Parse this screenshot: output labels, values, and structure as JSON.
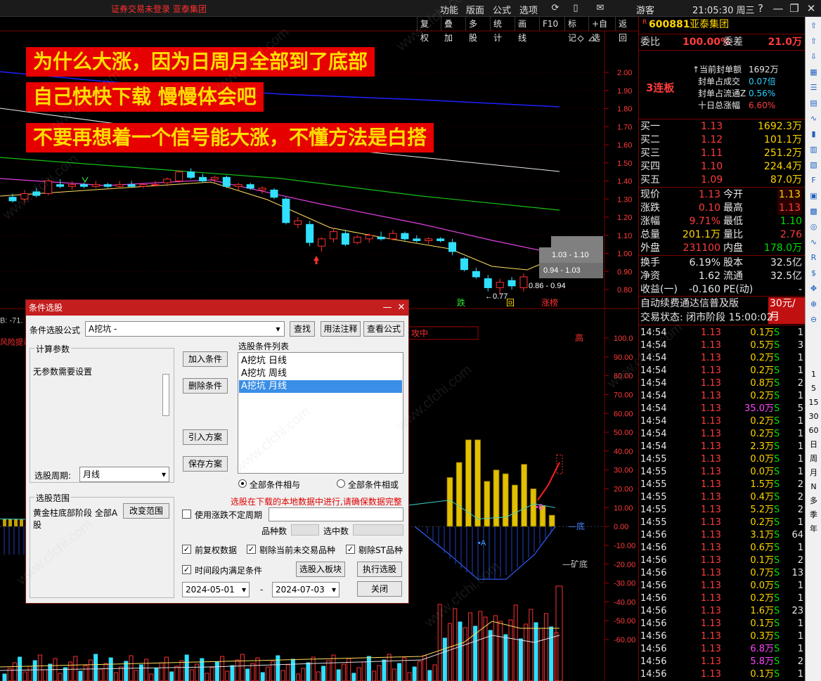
{
  "titlebar": {
    "notice": "证券交易未登录  亚泰集团",
    "menu": [
      "功能",
      "版面",
      "公式",
      "选项"
    ],
    "user": "游客",
    "time": "21:05:30 周三",
    "icons": [
      "refresh-icon",
      "phone-icon",
      "mail-icon"
    ]
  },
  "chart_toolbar": [
    "复权",
    "叠加",
    "多股",
    "统计",
    "画线",
    "F10",
    "标记",
    "+自选",
    "返回"
  ],
  "banners": [
    "为什么大涨，因为日周月全部到了底部",
    "自己快快下载     慢慢体会吧",
    "不要再想着一个信号能大涨，不懂方法是白搭"
  ],
  "watermark": "www.cfchi.com",
  "chart_data": {
    "type": "candlestick",
    "price_axis": [
      "2.00",
      "1.90",
      "1.80",
      "1.70",
      "1.60",
      "1.50",
      "1.40",
      "1.30",
      "1.20",
      "1.10",
      "1.00",
      "0.90",
      "0.80"
    ],
    "price_range": [
      0.75,
      2.05
    ],
    "annotations": {
      "range_label_1": "1.03 - 1.10",
      "range_label_2": "0.94 - 1.03",
      "range_label_3": "0.86 - 0.94",
      "low_label": "←0.77",
      "tag_die": "跌",
      "tag_hui": "回",
      "tag_zhangbang": "涨榜"
    },
    "indicator_axis": [
      "100.0",
      "90.00",
      "80.00",
      "70.00",
      "60.00",
      "50.00",
      "40.00",
      "30.00",
      "20.00",
      "10.00",
      "0.00",
      "-10.00",
      "-20.00",
      "-30.00",
      "-40.00",
      "-50.00",
      "-60.00"
    ],
    "indicator_labels": {
      "high": "高",
      "bottom": "底",
      "mine_bottom": "矿底",
      "marker_a": "A",
      "marker_b": "B",
      "left_cut": "B: -71.",
      "risk": "风险提示"
    },
    "bars": [
      26,
      34,
      46,
      46,
      24,
      30,
      28,
      22,
      33,
      20,
      11,
      6
    ],
    "candles": [
      {
        "o": 1.31,
        "h": 1.33,
        "l": 1.28,
        "c": 1.29
      },
      {
        "o": 1.3,
        "h": 1.35,
        "l": 1.28,
        "c": 1.33
      },
      {
        "o": 1.34,
        "h": 1.36,
        "l": 1.31,
        "c": 1.32
      },
      {
        "o": 1.33,
        "h": 1.41,
        "l": 1.32,
        "c": 1.4
      },
      {
        "o": 1.38,
        "h": 1.41,
        "l": 1.36,
        "c": 1.37
      },
      {
        "o": 1.37,
        "h": 1.4,
        "l": 1.35,
        "c": 1.38
      },
      {
        "o": 1.38,
        "h": 1.39,
        "l": 1.36,
        "c": 1.37
      },
      {
        "o": 1.37,
        "h": 1.4,
        "l": 1.36,
        "c": 1.38
      },
      {
        "o": 1.38,
        "h": 1.39,
        "l": 1.36,
        "c": 1.37
      },
      {
        "o": 1.37,
        "h": 1.4,
        "l": 1.36,
        "c": 1.38
      },
      {
        "o": 1.38,
        "h": 1.4,
        "l": 1.37,
        "c": 1.37
      },
      {
        "o": 1.37,
        "h": 1.39,
        "l": 1.36,
        "c": 1.38
      },
      {
        "o": 1.38,
        "h": 1.4,
        "l": 1.37,
        "c": 1.38
      },
      {
        "o": 1.39,
        "h": 1.42,
        "l": 1.37,
        "c": 1.41
      },
      {
        "o": 1.4,
        "h": 1.46,
        "l": 1.39,
        "c": 1.45
      },
      {
        "o": 1.45,
        "h": 1.47,
        "l": 1.41,
        "c": 1.42
      },
      {
        "o": 1.42,
        "h": 1.44,
        "l": 1.39,
        "c": 1.4
      },
      {
        "o": 1.41,
        "h": 1.43,
        "l": 1.39,
        "c": 1.42
      },
      {
        "o": 1.42,
        "h": 1.43,
        "l": 1.36,
        "c": 1.37
      },
      {
        "o": 1.37,
        "h": 1.39,
        "l": 1.35,
        "c": 1.38
      },
      {
        "o": 1.38,
        "h": 1.39,
        "l": 1.35,
        "c": 1.36
      },
      {
        "o": 1.35,
        "h": 1.37,
        "l": 1.33,
        "c": 1.36
      },
      {
        "o": 1.35,
        "h": 1.36,
        "l": 1.3,
        "c": 1.31
      },
      {
        "o": 1.3,
        "h": 1.31,
        "l": 1.16,
        "c": 1.17
      },
      {
        "o": 1.16,
        "h": 1.2,
        "l": 1.14,
        "c": 1.18
      },
      {
        "o": 1.16,
        "h": 1.18,
        "l": 1.04,
        "c": 1.06
      },
      {
        "o": 1.04,
        "h": 1.09,
        "l": 1.01,
        "c": 1.08
      },
      {
        "o": 1.08,
        "h": 1.14,
        "l": 1.06,
        "c": 1.12
      },
      {
        "o": 1.11,
        "h": 1.13,
        "l": 1.04,
        "c": 1.05
      },
      {
        "o": 1.06,
        "h": 1.1,
        "l": 1.05,
        "c": 1.09
      },
      {
        "o": 1.08,
        "h": 1.11,
        "l": 1.06,
        "c": 1.1
      },
      {
        "o": 1.09,
        "h": 1.12,
        "l": 1.07,
        "c": 1.08
      },
      {
        "o": 1.08,
        "h": 1.13,
        "l": 1.07,
        "c": 1.11
      },
      {
        "o": 1.11,
        "h": 1.12,
        "l": 1.07,
        "c": 1.08
      },
      {
        "o": 1.08,
        "h": 1.1,
        "l": 1.06,
        "c": 1.07
      },
      {
        "o": 1.07,
        "h": 1.09,
        "l": 1.05,
        "c": 1.08
      },
      {
        "o": 1.08,
        "h": 1.09,
        "l": 1.06,
        "c": 1.07
      },
      {
        "o": 1.06,
        "h": 1.08,
        "l": 0.99,
        "c": 1.01
      },
      {
        "o": 0.97,
        "h": 0.98,
        "l": 0.9,
        "c": 0.91
      },
      {
        "o": 0.9,
        "h": 0.92,
        "l": 0.86,
        "c": 0.87
      },
      {
        "o": 0.86,
        "h": 0.88,
        "l": 0.79,
        "c": 0.81
      },
      {
        "o": 0.81,
        "h": 0.86,
        "l": 0.77,
        "c": 0.84
      },
      {
        "o": 0.85,
        "h": 0.87,
        "l": 0.8,
        "c": 0.82
      },
      {
        "o": 0.81,
        "h": 0.89,
        "l": 0.79,
        "c": 0.87
      }
    ]
  },
  "stock": {
    "code": "600881",
    "name": "亚泰集团",
    "weibi_label": "委比",
    "weibi": "100.00%",
    "weicha_label": "委差",
    "weicha": "21.0万",
    "lianban": "3连板",
    "seal": [
      {
        "label": "当前封单额",
        "value": "1692万"
      },
      {
        "label": "封单占成交",
        "value": "0.07倍"
      },
      {
        "label": "封单占流通Z",
        "value": "0.56%"
      },
      {
        "label": "十日总涨幅",
        "value": "6.60%"
      }
    ],
    "bids": [
      {
        "label": "买一",
        "price": "1.13",
        "vol": "1692.3万"
      },
      {
        "label": "买二",
        "price": "1.12",
        "vol": "101.1万"
      },
      {
        "label": "买三",
        "price": "1.11",
        "vol": "251.2万"
      },
      {
        "label": "买四",
        "price": "1.10",
        "vol": "224.4万"
      },
      {
        "label": "买五",
        "price": "1.09",
        "vol": "87.0万"
      }
    ],
    "quote": [
      {
        "l1": "现价",
        "v1": "1.13",
        "l2": "今开",
        "v2": "1.13"
      },
      {
        "l1": "涨跌",
        "v1": "0.10",
        "l2": "最高",
        "v2": "1.13"
      },
      {
        "l1": "涨幅",
        "v1": "9.71%",
        "l2": "最低",
        "v2": "1.10"
      },
      {
        "l1": "总量",
        "v1": "201.1万",
        "l2": "量比",
        "v2": "2.76"
      },
      {
        "l1": "外盘",
        "v1": "231100",
        "l2": "内盘",
        "v2": "178.0万"
      }
    ],
    "fin": [
      {
        "l1": "换手",
        "v1": "6.19%",
        "l2": "股本",
        "v2": "32.5亿"
      },
      {
        "l1": "净资",
        "v1": "1.62",
        "l2": "流通",
        "v2": "32.5亿"
      },
      {
        "l1": "收益(一)",
        "v1": "-0.160",
        "l2": "PE(动)",
        "v2": "-"
      }
    ],
    "promo": "自动续费通达信普及版",
    "promo_price": "30元/月",
    "status": "交易状态: 闭市阶段 15:00:02",
    "ticks": [
      [
        "14:54",
        "1.13",
        "0.1万",
        "S",
        "1"
      ],
      [
        "14:54",
        "1.13",
        "0.5万",
        "S",
        "3"
      ],
      [
        "14:54",
        "1.13",
        "0.2万",
        "S",
        "1"
      ],
      [
        "14:54",
        "1.13",
        "0.2万",
        "S",
        "1"
      ],
      [
        "14:54",
        "1.13",
        "0.8万",
        "S",
        "2"
      ],
      [
        "14:54",
        "1.13",
        "0.2万",
        "S",
        "1"
      ],
      [
        "14:54",
        "1.13",
        "35.0万",
        "S",
        "5"
      ],
      [
        "14:54",
        "1.13",
        "0.2万",
        "S",
        "1"
      ],
      [
        "14:54",
        "1.13",
        "0.2万",
        "S",
        "1"
      ],
      [
        "14:54",
        "1.13",
        "2.3万",
        "S",
        "1"
      ],
      [
        "14:55",
        "1.13",
        "0.0万",
        "S",
        "1"
      ],
      [
        "14:55",
        "1.13",
        "0.0万",
        "S",
        "1"
      ],
      [
        "14:55",
        "1.13",
        "1.5万",
        "S",
        "2"
      ],
      [
        "14:55",
        "1.13",
        "0.4万",
        "S",
        "2"
      ],
      [
        "14:55",
        "1.13",
        "5.2万",
        "S",
        "2"
      ],
      [
        "14:55",
        "1.13",
        "0.2万",
        "S",
        "1"
      ],
      [
        "14:56",
        "1.13",
        "3.1万",
        "S",
        "64"
      ],
      [
        "14:56",
        "1.13",
        "0.6万",
        "S",
        "1"
      ],
      [
        "14:56",
        "1.13",
        "0.1万",
        "S",
        "2"
      ],
      [
        "14:56",
        "1.13",
        "0.7万",
        "S",
        "13"
      ],
      [
        "14:56",
        "1.13",
        "0.0万",
        "S",
        "1"
      ],
      [
        "14:56",
        "1.13",
        "0.2万",
        "S",
        "1"
      ],
      [
        "14:56",
        "1.13",
        "1.6万",
        "S",
        "23"
      ],
      [
        "14:56",
        "1.13",
        "0.1万",
        "S",
        "1"
      ],
      [
        "14:56",
        "1.13",
        "0.3万",
        "S",
        "1"
      ],
      [
        "14:56",
        "1.13",
        "6.8万",
        "S",
        "1"
      ],
      [
        "14:56",
        "1.13",
        "5.8万",
        "S",
        "2"
      ],
      [
        "14:56",
        "1.13",
        "0.1万",
        "S",
        "1"
      ]
    ]
  },
  "sidebar": [
    "1",
    "5",
    "15",
    "30",
    "60",
    "日",
    "周",
    "月",
    "N",
    "多",
    "季",
    "年"
  ],
  "sidebar_icons": [
    "arrow-up-icon",
    "arrow-up-icon",
    "arrow-down-icon",
    "grid-icon",
    "list-icon",
    "table-icon",
    "line-chart-icon",
    "candle-chart-icon",
    "book-icon",
    "fund-icon",
    "f10-icon",
    "news-icon",
    "bar-icon",
    "target-icon",
    "wave-icon",
    "rsi-icon",
    "dollar-icon",
    "move-icon",
    "zoom-in-icon",
    "zoom-out-icon"
  ],
  "dialog": {
    "title": "条件选股",
    "formula_label": "条件选股公式",
    "formula_value": "A挖坑  -",
    "btn_find": "查找",
    "btn_usage": "用法注释",
    "btn_view": "查看公式",
    "params_title": "计算参数",
    "params_text": "无参数需要设置",
    "period_label": "选股周期:",
    "period_value": "月线",
    "btn_add": "加入条件",
    "btn_delete": "删除条件",
    "btn_import": "引入方案",
    "btn_save": "保存方案",
    "list_title": "选股条件列表",
    "conditions": [
      "A挖坑  日线",
      "A挖坑  周线",
      "A挖坑  月线"
    ],
    "radio_and": "全部条件相与",
    "radio_or": "全部条件相或",
    "warning": "选股在下载的本地数据中进行,请确保数据完整",
    "scope_title": "选股范围",
    "scope_text": "黄金柱底部阶段 全部A股",
    "btn_change": "改变范围",
    "chk_uncertain": "使用涨跌不定周期",
    "count_label": "品种数",
    "selected_label": "选中数",
    "chk_fq": "前复权数据",
    "chk_untraded": "剔除当前未交易品种",
    "chk_st": "剔除ST品种",
    "chk_period": "时间段内满足条件",
    "btn_to_block": "选股入板块",
    "btn_execute": "执行选股",
    "date_from": "2024-05-01",
    "date_sep": "-",
    "date_to": "2024-07-03",
    "btn_close": "关闭"
  }
}
